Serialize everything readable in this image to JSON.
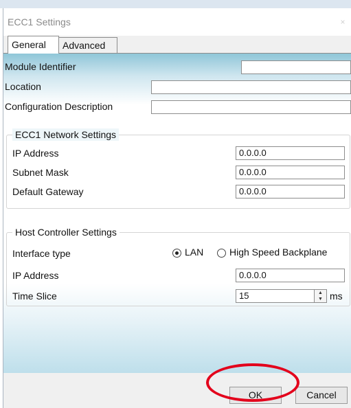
{
  "window": {
    "title": "ECC1 Settings",
    "close_glyph": "×"
  },
  "tabs": [
    {
      "label": "General",
      "active": true
    },
    {
      "label": "Advanced",
      "active": false
    }
  ],
  "general": {
    "module_identifier": {
      "label": "Module Identifier",
      "value": ""
    },
    "location": {
      "label": "Location",
      "value": ""
    },
    "configuration_description": {
      "label": "Configuration Description",
      "value": ""
    }
  },
  "network": {
    "title": "ECC1 Network Settings",
    "ip_address": {
      "label": "IP Address",
      "value": "0.0.0.0"
    },
    "subnet_mask": {
      "label": "Subnet Mask",
      "value": "0.0.0.0"
    },
    "default_gateway": {
      "label": "Default Gateway",
      "value": "0.0.0.0"
    }
  },
  "host": {
    "title": "Host Controller Settings",
    "interface_type": {
      "label": "Interface type",
      "options": [
        {
          "label": "LAN",
          "selected": true
        },
        {
          "label": "High Speed Backplane",
          "selected": false
        }
      ]
    },
    "ip_address": {
      "label": "IP Address",
      "value": "0.0.0.0"
    },
    "time_slice": {
      "label": "Time Slice",
      "value": "15",
      "unit": "ms"
    }
  },
  "buttons": {
    "ok": "OK",
    "cancel": "Cancel"
  },
  "colors": {
    "highlight_ring": "#e3001b",
    "panel_gradient_accent": "#8fc6d8"
  }
}
